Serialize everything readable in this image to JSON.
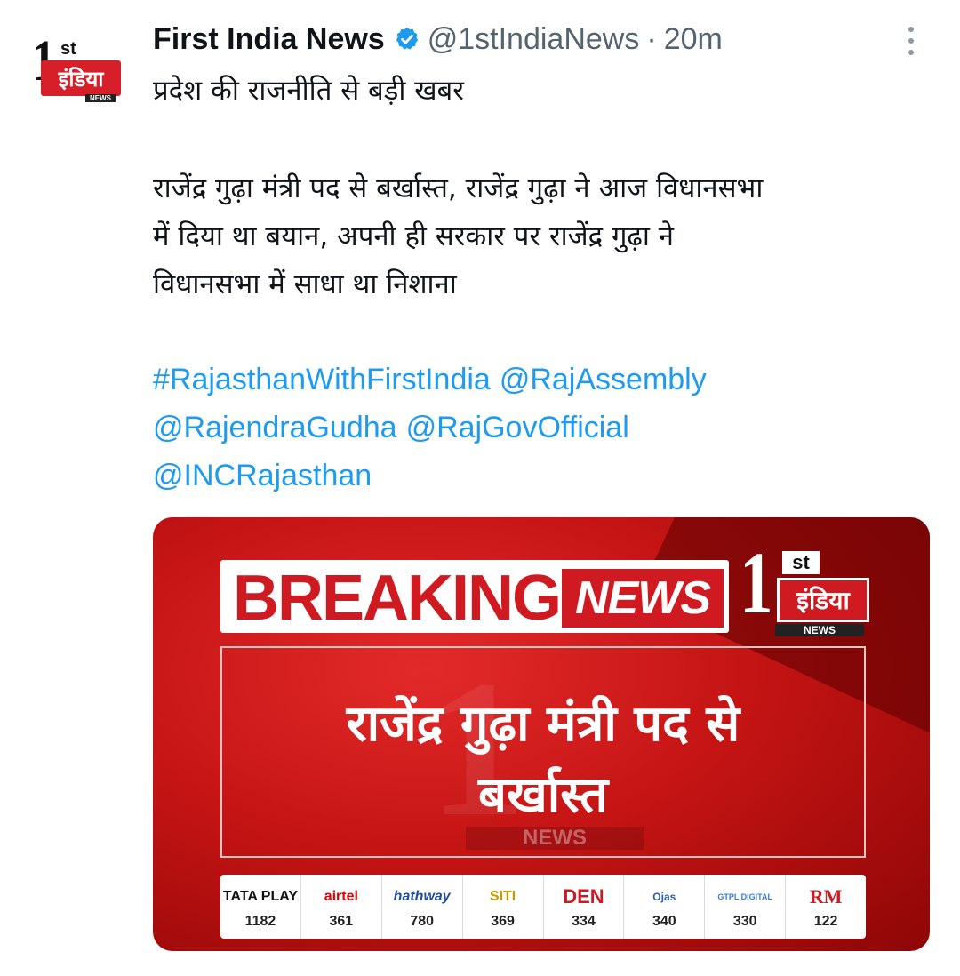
{
  "tweet": {
    "author_name": "First India News",
    "handle": "@1stIndiaNews",
    "separator": "·",
    "time": "20m",
    "lines": [
      "प्रदेश की राजनीति से बड़ी खबर",
      "राजेंद्र गुढ़ा मंत्री पद से बर्खास्त, राजेंद्र गुढ़ा ने आज विधानसभा",
      "में दिया था बयान, अपनी ही सरकार पर राजेंद्र गुढ़ा ने",
      "विधानसभा में साधा था निशाना"
    ],
    "links": {
      "hashtag": "#RajasthanWithFirstIndia",
      "mention1": "@RajAssembly",
      "mention2": "@RajendraGudha",
      "mention3": "@RajGovOfficial",
      "mention4": "@INCRajasthan"
    }
  },
  "avatar": {
    "one": "1",
    "st": "st",
    "india": "इंडिया",
    "news": "NEWS"
  },
  "media": {
    "breaking": "BREAKING",
    "news": "NEWS",
    "logo_one": "1",
    "logo_st": "st",
    "logo_india": "इंडिया",
    "logo_news": "NEWS",
    "headline_line1": "राजेंद्र गुढ़ा मंत्री पद से",
    "headline_line2": "बर्खास्त",
    "watermark_one": "1",
    "watermark_news": "NEWS",
    "channels": [
      {
        "name": "TATA PLAY",
        "number": "1182",
        "color": "#111111"
      },
      {
        "name": "airtel",
        "number": "361",
        "color": "#e40000"
      },
      {
        "name": "hathway",
        "number": "780",
        "color": "#1f4e9c"
      },
      {
        "name": "SITI",
        "number": "369",
        "color": "#c89b00"
      },
      {
        "name": "DEN",
        "number": "334",
        "color": "#d01a21"
      },
      {
        "name": "Ojas",
        "number": "340",
        "color": "#2a5caa"
      },
      {
        "name": "GTPL DIGITAL",
        "number": "330",
        "color": "#3a7bd5"
      },
      {
        "name": "RM",
        "number": "122",
        "color": "#d01a21"
      }
    ]
  },
  "colors": {
    "link": "#1d9bf0",
    "secondary_text": "#536471",
    "verified": "#1d9bf0",
    "brand_red": "#d01a21"
  }
}
